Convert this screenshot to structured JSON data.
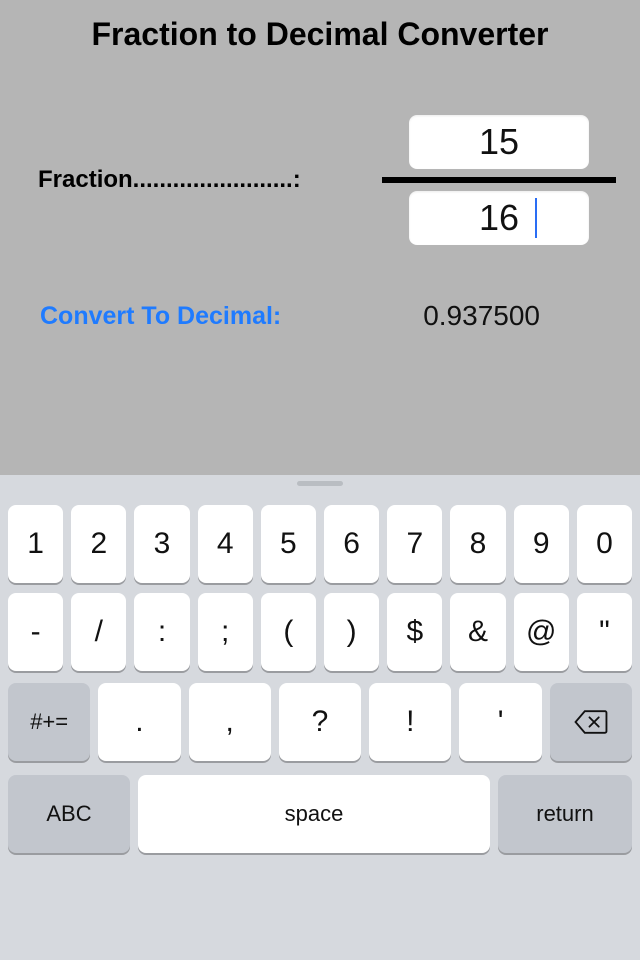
{
  "title": "Fraction to Decimal Converter",
  "fraction": {
    "label": "Fraction........................:",
    "numerator": "15",
    "denominator": "16"
  },
  "result": {
    "label": "Convert To Decimal:",
    "value": "0.937500"
  },
  "keyboard": {
    "row1": [
      "1",
      "2",
      "3",
      "4",
      "5",
      "6",
      "7",
      "8",
      "9",
      "0"
    ],
    "row2": [
      "-",
      "/",
      ":",
      ";",
      "(",
      ")",
      "$",
      "&",
      "@",
      "\""
    ],
    "row3": {
      "shift": "#+=",
      "keys": [
        ".",
        ",",
        "?",
        "!",
        "'"
      ],
      "delete": "delete"
    },
    "row4": {
      "abc": "ABC",
      "space": "space",
      "ret": "return"
    }
  }
}
